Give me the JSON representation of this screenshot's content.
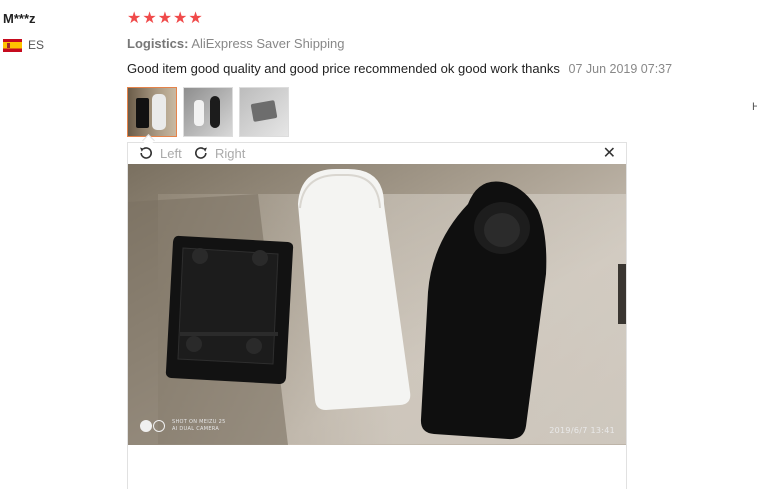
{
  "review": {
    "user_name": "M***z",
    "country_code": "ES",
    "rating": 5,
    "stars": [
      "★",
      "★",
      "★",
      "★",
      "★"
    ],
    "logistics_label": "Logistics:",
    "logistics_value": "AliExpress Saver Shipping",
    "text": "Good item good quality and good price recommended ok good work thanks",
    "date": "07 Jun 2019 07:37",
    "thumbnails": [
      {
        "label": "photo-1",
        "active": true
      },
      {
        "label": "photo-2",
        "active": false
      },
      {
        "label": "photo-3",
        "active": false
      }
    ]
  },
  "viewer": {
    "rotate_left_label": "Left",
    "rotate_right_label": "Right",
    "close_glyph": "✕",
    "photo_date_stamp": "2019/6/7  13:41",
    "camera_line_1": "SHOT ON MEIZU 25",
    "camera_line_2": "AI DUAL CAMERA"
  },
  "edge_text": "H",
  "colors": {
    "star": "#f04a4a",
    "active_thumb_border": "#e5834a",
    "muted_text": "#888888"
  }
}
